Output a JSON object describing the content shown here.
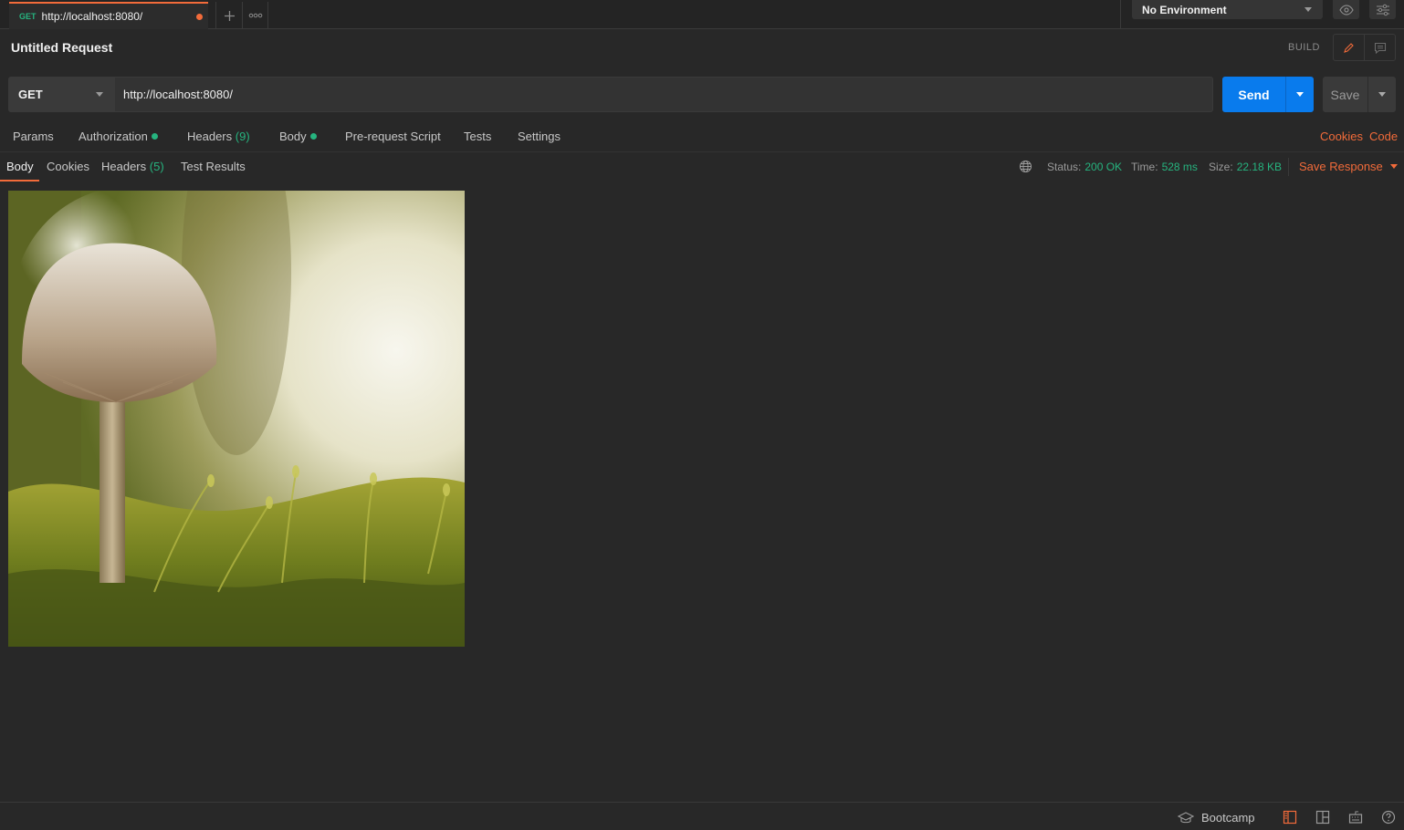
{
  "tab": {
    "method": "GET",
    "url": "http://localhost:8080/",
    "unsaved": true
  },
  "tab_actions": {
    "new_tab_icon": "plus-icon",
    "more_icon": "ellipsis-icon"
  },
  "environment": {
    "selected": "No Environment",
    "icons": [
      "eye-icon",
      "sliders-icon"
    ]
  },
  "request": {
    "title": "Untitled Request",
    "mode_label": "BUILD",
    "mode_icons": [
      "pencil-icon",
      "comment-icon"
    ],
    "method": "GET",
    "url": "http://localhost:8080/",
    "send_label": "Send",
    "save_label": "Save"
  },
  "request_tabs": {
    "params": "Params",
    "authorization": "Authorization",
    "headers": "Headers",
    "headers_count": "(9)",
    "body": "Body",
    "pre_request": "Pre-request Script",
    "tests": "Tests",
    "settings": "Settings",
    "cookies_link": "Cookies",
    "code_link": "Code"
  },
  "response_tabs": {
    "body": "Body",
    "cookies": "Cookies",
    "headers": "Headers",
    "headers_count": "(5)",
    "test_results": "Test Results",
    "active": "Body"
  },
  "response_meta": {
    "globe_icon": "globe-icon",
    "status_label": "Status:",
    "status_value": "200 OK",
    "time_label": "Time:",
    "time_value": "528 ms",
    "size_label": "Size:",
    "size_value": "22.18 KB",
    "save_response": "Save Response"
  },
  "response_body": {
    "kind": "image",
    "description_icon": "mushroom-photo"
  },
  "statusbar": {
    "bootcamp": "Bootcamp",
    "icons": [
      "graduation-cap-icon",
      "two-pane-icon",
      "layout-icon",
      "keyboard-icon",
      "help-icon"
    ]
  },
  "colors": {
    "accent": "#f26b3a",
    "success": "#26b47f",
    "primary": "#097bed",
    "background": "#282828"
  }
}
